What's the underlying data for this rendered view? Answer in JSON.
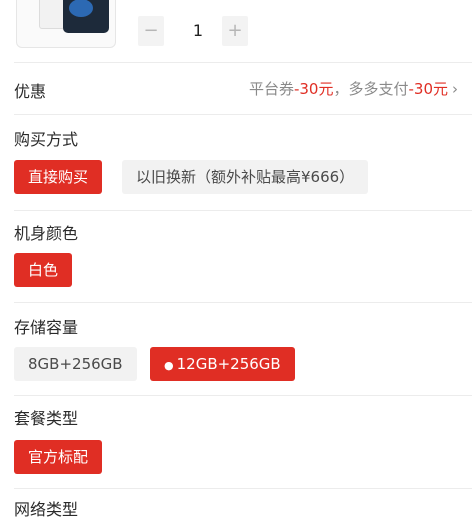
{
  "product": {
    "thumbnail_icon": "phone-product-icon",
    "quantity": "1",
    "minus_label": "−",
    "plus_label": "+"
  },
  "discount": {
    "label": "优惠",
    "platform_prefix": "平台券",
    "platform_amount": "-30元",
    "separator": "，",
    "pay_prefix": "多多支付",
    "pay_amount": "-30元",
    "chevron": "›"
  },
  "purchase_method": {
    "label": "购买方式",
    "options": [
      {
        "label": "直接购买",
        "selected": true
      },
      {
        "label": "以旧换新（额外补贴最高¥666）",
        "selected": false
      }
    ]
  },
  "color": {
    "label": "机身颜色",
    "options": [
      {
        "label": "白色",
        "selected": true
      }
    ]
  },
  "storage": {
    "label": "存储容量",
    "options": [
      {
        "label": "8GB+256GB",
        "selected": false
      },
      {
        "label": "12GB+256GB",
        "selected": true,
        "icon": "fire-icon"
      }
    ]
  },
  "package": {
    "label": "套餐类型",
    "options": [
      {
        "label": "官方标配",
        "selected": true
      }
    ]
  },
  "network": {
    "label": "网络类型"
  },
  "colors": {
    "accent": "#e02e24",
    "unselected_bg": "#f2f2f2",
    "text": "#2a2a2a",
    "muted": "#8a8a8a"
  }
}
